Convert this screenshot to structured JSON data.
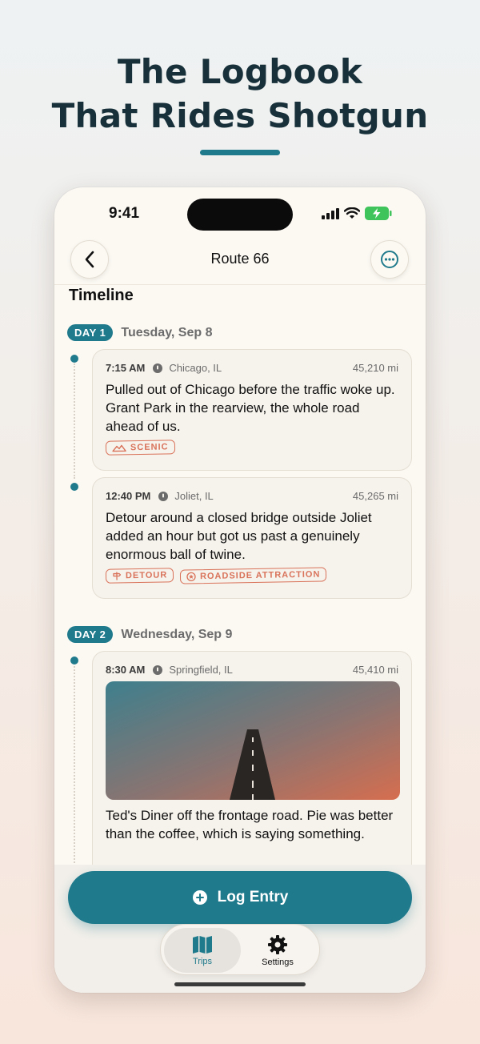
{
  "headline": {
    "line1": "The Logbook",
    "line2": "That Rides Shotgun"
  },
  "status_bar": {
    "time": "9:41"
  },
  "nav": {
    "title": "Route 66"
  },
  "section_title": "Timeline",
  "days": [
    {
      "pill": "DAY 1",
      "date": "Tuesday, Sep 8",
      "entries": [
        {
          "time": "7:15 AM",
          "place": "Chicago, IL",
          "miles": "45,210 mi",
          "text": "Pulled out of Chicago before the traffic woke up. Grant Park in the rearview, the whole road ahead of us.",
          "tags": [
            {
              "label": "SCENIC",
              "icon": "mountain-icon"
            }
          ]
        },
        {
          "time": "12:40 PM",
          "place": "Joliet, IL",
          "miles": "45,265 mi",
          "text": "Detour around a closed bridge outside Joliet added an hour but got us past a genuinely enormous ball of twine.",
          "tags": [
            {
              "label": "DETOUR",
              "icon": "signpost-icon"
            },
            {
              "label": "ROADSIDE ATTRACTION",
              "icon": "star-badge-icon"
            }
          ]
        }
      ]
    },
    {
      "pill": "DAY 2",
      "date": "Wednesday, Sep 9",
      "entries": [
        {
          "time": "8:30 AM",
          "place": "Springfield, IL",
          "miles": "45,410 mi",
          "text": "Ted's Diner off the frontage road. Pie was better than the coffee, which is saying something.",
          "photo": "road-photo"
        }
      ]
    }
  ],
  "log_button": {
    "label": "Log Entry",
    "icon": "plus-circle-icon"
  },
  "tabs": [
    {
      "label": "Trips",
      "icon": "map-icon",
      "active": true
    },
    {
      "label": "Settings",
      "icon": "gear-icon",
      "active": false
    }
  ],
  "colors": {
    "accent": "#1f7a8c",
    "tag": "#d9735a",
    "headline": "#173039"
  }
}
